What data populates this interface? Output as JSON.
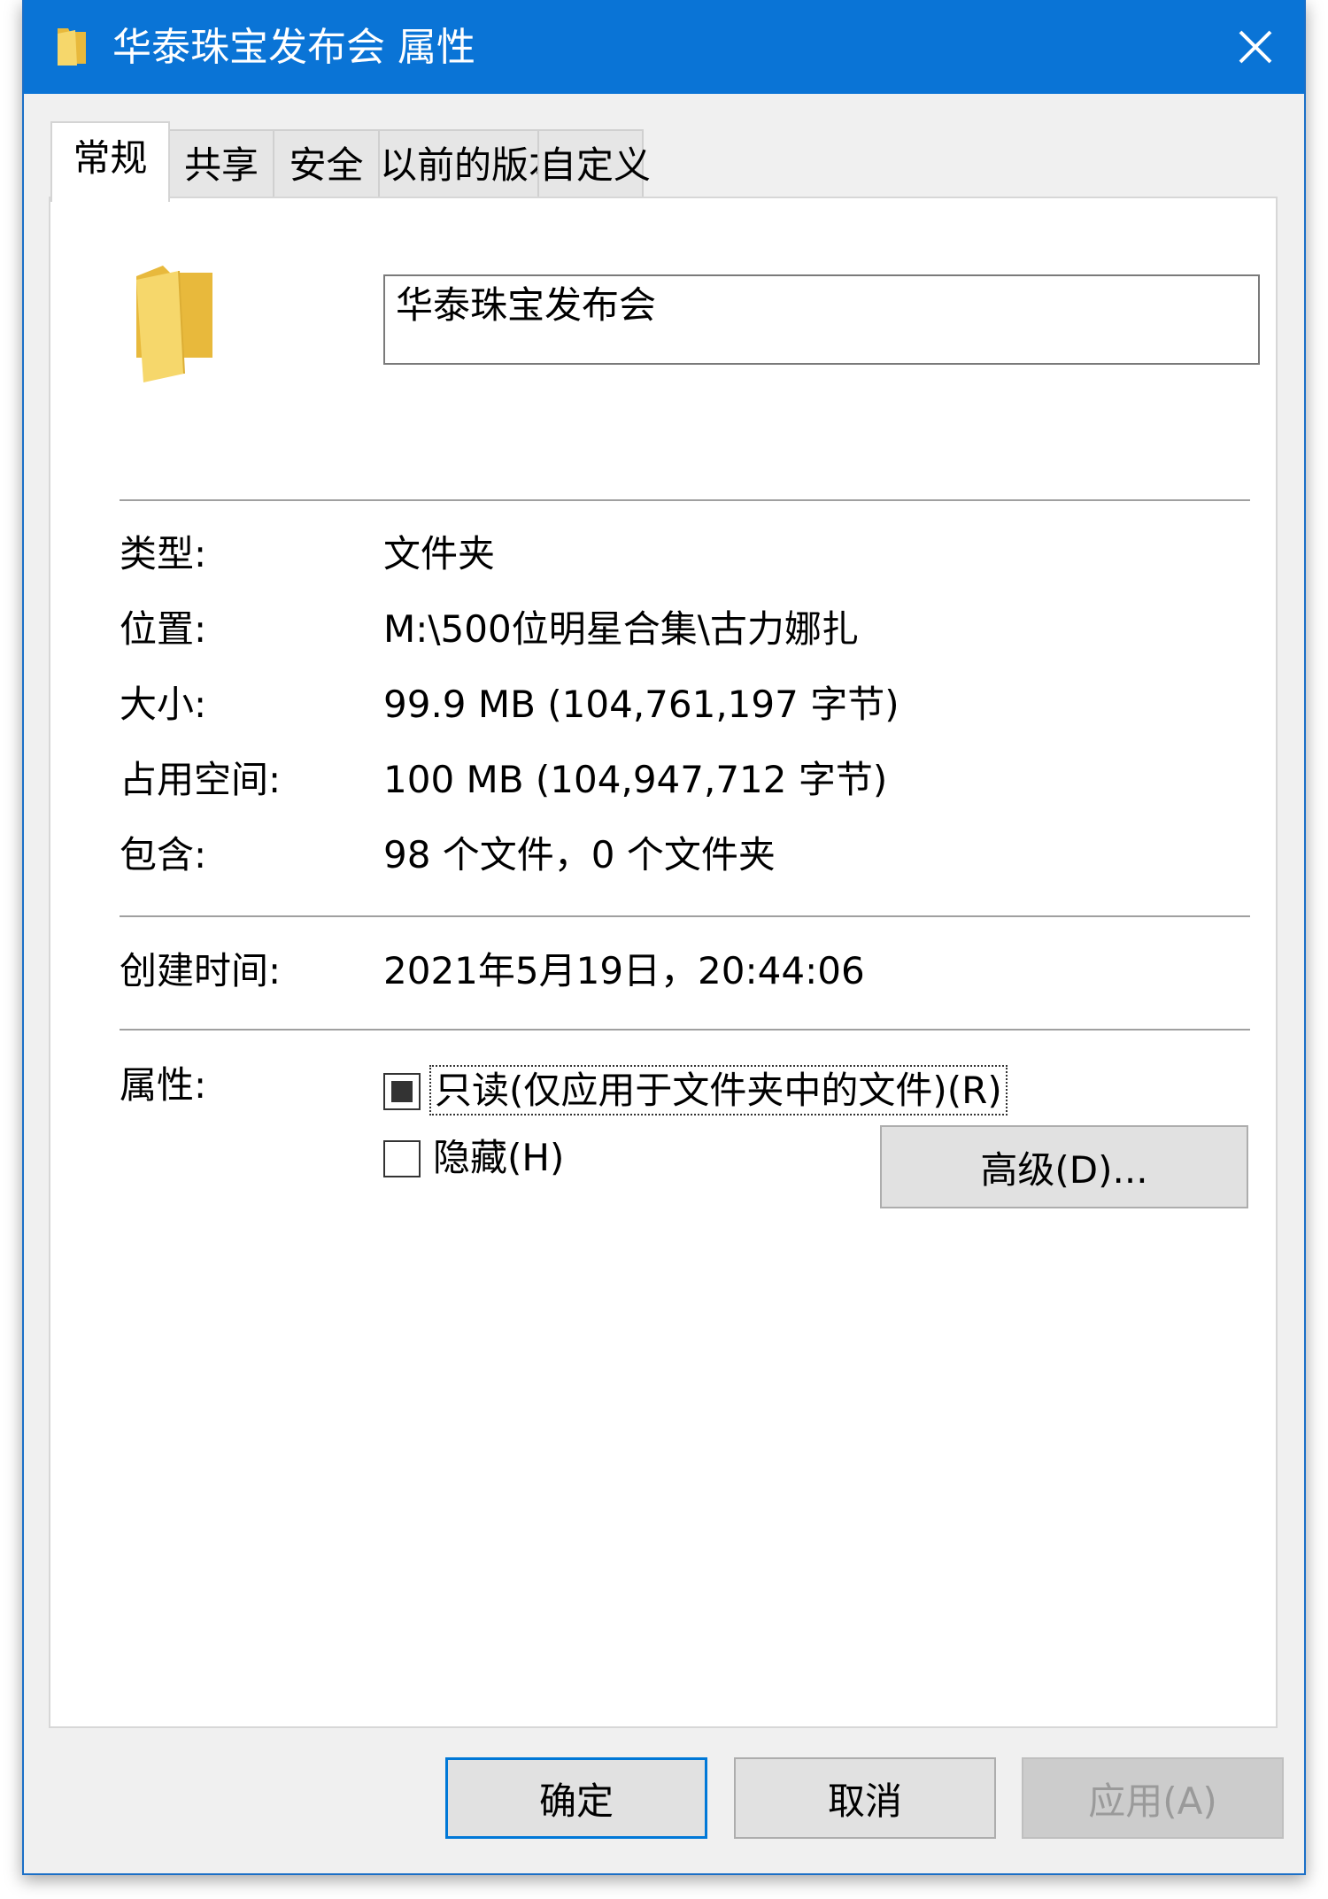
{
  "window": {
    "title": "华泰珠宝发布会 属性",
    "colors": {
      "titlebar": "#0a74d6",
      "folder": "#f6d76b",
      "accent": "#0078d7"
    }
  },
  "tabs": [
    {
      "label": "常规",
      "active": true
    },
    {
      "label": "共享"
    },
    {
      "label": "安全"
    },
    {
      "label": "以前的版本"
    },
    {
      "label": "自定义"
    }
  ],
  "general": {
    "name_value": "华泰珠宝发布会",
    "type": {
      "label": "类型:",
      "value": "文件夹"
    },
    "location": {
      "label": "位置:",
      "value": "M:\\500位明星合集\\古力娜扎"
    },
    "size": {
      "label": "大小:",
      "value": "99.9 MB (104,761,197 字节)"
    },
    "size_on_disk": {
      "label": "占用空间:",
      "value": "100 MB (104,947,712 字节)"
    },
    "contains": {
      "label": "包含:",
      "value": "98 个文件，0 个文件夹"
    },
    "created": {
      "label": "创建时间:",
      "value": "2021年5月19日，20:44:06"
    },
    "attributes": {
      "label": "属性:",
      "readonly": {
        "label": "只读(仅应用于文件夹中的文件)(R)",
        "state": "indeterminate"
      },
      "hidden": {
        "label": "隐藏(H)",
        "state": "unchecked"
      },
      "advanced_button": "高级(D)..."
    }
  },
  "buttons": {
    "ok": "确定",
    "cancel": "取消",
    "apply": "应用(A)"
  }
}
